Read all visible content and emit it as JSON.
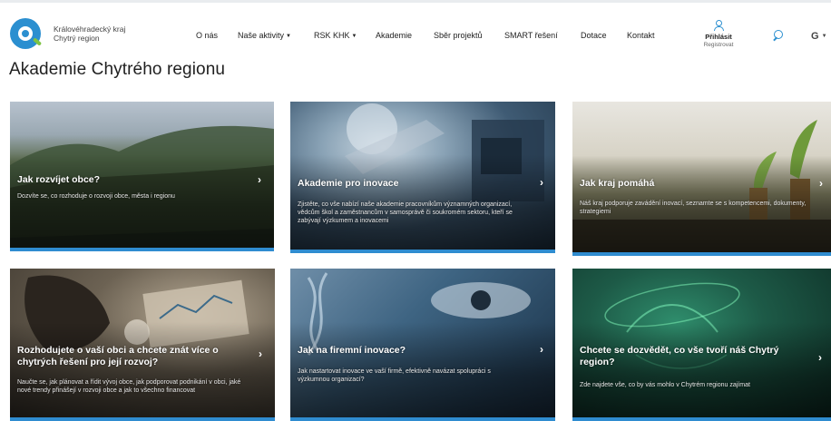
{
  "header": {
    "brand_line1": "Královéhradecký kraj",
    "brand_line2": "Chytrý region",
    "nav": [
      {
        "label": "O nás",
        "dropdown": false
      },
      {
        "label": "Naše aktivity",
        "dropdown": true
      },
      {
        "label": "RSK KHK",
        "dropdown": true
      },
      {
        "label": "Akademie",
        "dropdown": false
      },
      {
        "label": "Sběr projektů",
        "dropdown": false
      },
      {
        "label": "SMART řešení",
        "dropdown": false
      },
      {
        "label": "Dotace",
        "dropdown": false
      },
      {
        "label": "Kontakt",
        "dropdown": false
      }
    ],
    "login_label": "Přihlásit",
    "register_label": "Registrovat",
    "lang": "G",
    "icons": {
      "user": "user-icon",
      "search": "search-icon",
      "logo": "q-logo-icon"
    },
    "accent_color": "#2b8fd0"
  },
  "page_title": "Akademie Chytrého regionu",
  "cards": [
    {
      "title": "Jak rozvíjet obce?",
      "desc": "Dozvíte se, co rozhoduje o rozvoji obce, města i regionu"
    },
    {
      "title": "Akademie pro inovace",
      "desc": "Zjistěte, co vše nabízí naše akademie pracovníkům významných organizací, vědcům škol a zaměstnancům v samosprávě či soukromém sektoru, kteří se zabývají výzkumem a inovacemi"
    },
    {
      "title": "Jak kraj pomáhá",
      "desc": "Náš kraj podporuje zavádění inovací, seznamte se s kompetencemi, dokumenty, strategiemi"
    },
    {
      "title": "Rozhodujete o vaší obci a chcete znát více o chytrých řešení pro její rozvoj?",
      "desc": "Naučte se, jak plánovat a řídit vývoj obce, jak podporovat podnikání v obci, jaké nové trendy přinášejí v rozvoji obce a jak to všechno financovat"
    },
    {
      "title": "Jak na firemní inovace?",
      "desc": "Jak nastartovat inovace ve vaší firmě, efektivně navázat spolupráci s výzkumnou organizací?"
    },
    {
      "title": "Chcete se dozvědět, co vše tvoří náš Chytrý region?",
      "desc": "Zde najdete vše, co by vás mohlo v Chytrém regionu zajímat"
    }
  ],
  "card_arrow": "›",
  "card_bar_color": "#2f8cd0"
}
